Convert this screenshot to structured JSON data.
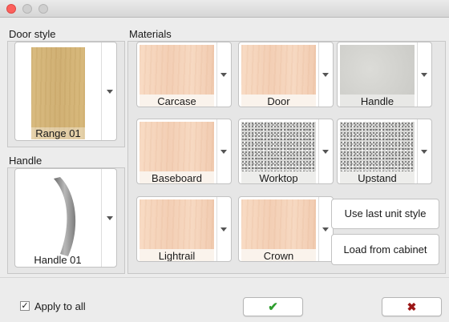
{
  "door_style": {
    "group_label": "Door style",
    "swatch_label": "Range 01"
  },
  "handle": {
    "group_label": "Handle",
    "swatch_label": "Handle 01"
  },
  "materials": {
    "group_label": "Materials",
    "items": [
      {
        "label": "Carcase",
        "texture": "wood"
      },
      {
        "label": "Door",
        "texture": "wood"
      },
      {
        "label": "Handle",
        "texture": "grey"
      },
      {
        "label": "Baseboard",
        "texture": "wood"
      },
      {
        "label": "Worktop",
        "texture": "granite"
      },
      {
        "label": "Upstand",
        "texture": "granite"
      },
      {
        "label": "Lightrail",
        "texture": "wood"
      },
      {
        "label": "Crown",
        "texture": "wood"
      }
    ],
    "use_last_unit_style_label": "Use last unit style",
    "load_from_cabinet_label": "Load from cabinet"
  },
  "apply_to_all": {
    "label": "Apply to all",
    "checked": true,
    "check_glyph": "✓"
  },
  "ok_button": {
    "icon": "check-icon",
    "glyph": "✔",
    "color": "#2e9e2e"
  },
  "cancel_button": {
    "icon": "x-icon",
    "glyph": "✖",
    "color": "#9b1616"
  },
  "colors": {
    "close_dot": "#fc605c",
    "wood": "#f5d5bc",
    "caption_bg": "#faf3ec"
  }
}
